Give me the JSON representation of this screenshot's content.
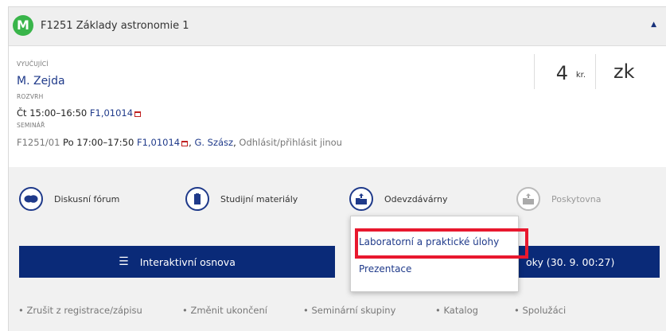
{
  "header": {
    "logo_letter": "M",
    "course_code": "F1251",
    "course_name": "Základy astronomie 1",
    "collapse_icon": "caret-up-icon",
    "logo_color": "#39b54a"
  },
  "info": {
    "teacher_label": "VYUČUJÍCÍ",
    "teacher_name": "M. Zejda",
    "schedule_label": "ROZVRH",
    "schedule_time": "Čt 15:00–16:50",
    "schedule_room": "F1,01014",
    "seminar_label": "SEMINÁŘ",
    "seminar_group": "F1251/01",
    "seminar_time": "Po 17:00–17:50",
    "seminar_room": "F1,01014",
    "seminar_teacher": "G. Szász",
    "seminar_action": "Odhlásit/přihlásit jinou",
    "credits": "4",
    "credits_unit": "kr.",
    "completion": "zk"
  },
  "tools": {
    "forum": {
      "label": "Diskusní fórum",
      "icon": "chat-bubbles-icon"
    },
    "materials": {
      "label": "Studijní materiály",
      "icon": "folder-icon"
    },
    "submissions": {
      "label": "Odevzdávárny",
      "icon": "folder-upload-icon"
    },
    "provided": {
      "label": "Poskytovna",
      "icon": "folder-upload-icon"
    }
  },
  "buttons": {
    "osnova": "Interaktivní osnova",
    "odevzdavarny_suffix": "oky (30. 9. 00:27)"
  },
  "dropdown": {
    "items": [
      "Laboratorní a praktické úlohy",
      "Prezentace"
    ]
  },
  "links": [
    "• Zrušit z registrace/zápisu",
    "• Změnit ukončení",
    "• Seminární skupiny",
    "• Katalog",
    "• Spolužáci"
  ],
  "colors": {
    "accent": "#0a2a78",
    "link": "#1f3a8a",
    "highlight": "#e8182e"
  }
}
